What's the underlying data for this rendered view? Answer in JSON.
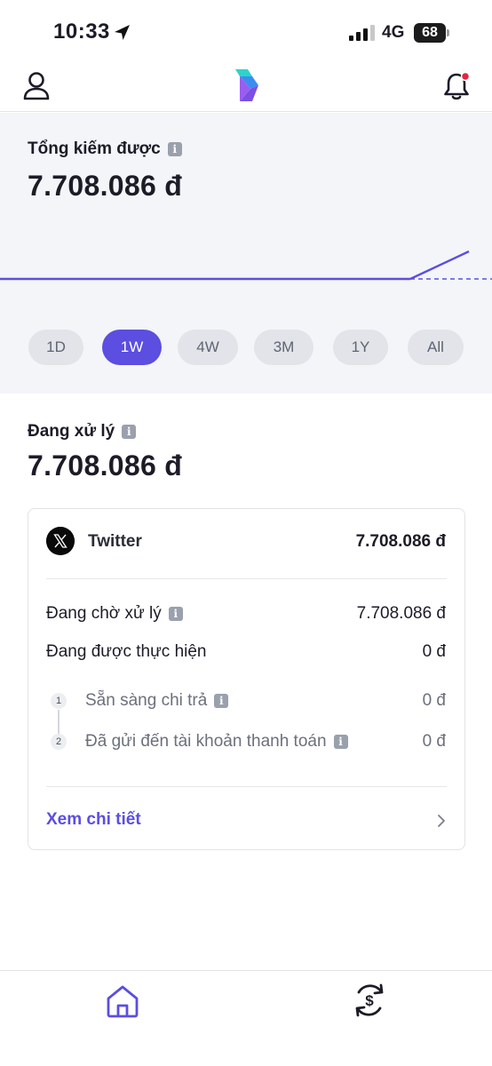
{
  "status_bar": {
    "time": "10:33",
    "network": "4G",
    "battery": "68"
  },
  "header": {
    "profile_icon": "user-icon",
    "logo": "app-logo",
    "bell_icon": "bell-icon",
    "has_notification_dot": true
  },
  "earnings": {
    "label": "Tổng kiếm được",
    "value": "7.708.086 đ",
    "periods": [
      "1D",
      "1W",
      "4W",
      "3M",
      "1Y",
      "All"
    ],
    "selected_period": "1W"
  },
  "processing": {
    "label": "Đang xử lý",
    "value": "7.708.086 đ",
    "card": {
      "source_name": "Twitter",
      "source_amount": "7.708.086 đ",
      "pending_label": "Đang chờ xử lý",
      "pending_amount": "7.708.086 đ",
      "in_progress_label": "Đang được thực hiện",
      "in_progress_amount": "0 đ",
      "steps": [
        {
          "num": "1",
          "label": "Sẵn sàng chi trả",
          "amount": "0 đ"
        },
        {
          "num": "2",
          "label": "Đã gửi đến tài khoản thanh toán",
          "amount": "0 đ"
        }
      ],
      "detail_link": "Xem chi tiết"
    }
  },
  "tab_bar": {
    "tabs": [
      "home-icon",
      "payout-exchange-icon"
    ]
  },
  "colors": {
    "accent": "#5b4ee0",
    "panel_bg": "#f4f5f8"
  }
}
